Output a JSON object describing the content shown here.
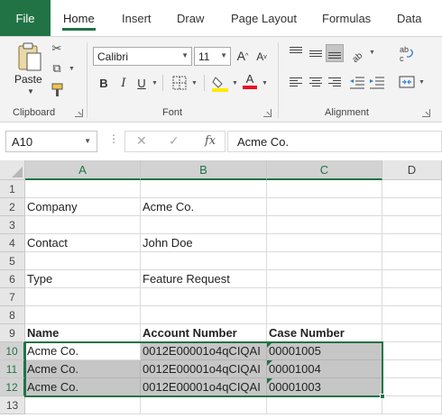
{
  "tabs": [
    "File",
    "Home",
    "Insert",
    "Draw",
    "Page Layout",
    "Formulas",
    "Data"
  ],
  "active_tab": "Home",
  "ribbon": {
    "clipboard": {
      "label": "Clipboard",
      "paste_label": "Paste"
    },
    "font": {
      "label": "Font",
      "font_name": "Calibri",
      "font_size": "11",
      "bold": "B",
      "italic": "I",
      "underline": "U",
      "grow": "A",
      "shrink": "A",
      "font_color_glyph": "A",
      "highlight_color": "#ffeb00",
      "font_color": "#e81123"
    },
    "alignment": {
      "label": "Alignment"
    }
  },
  "formula_bar": {
    "name_box": "A10",
    "content": "Acme Co.",
    "fx_label": "fx"
  },
  "columns": [
    "A",
    "B",
    "C",
    "D"
  ],
  "rows": [
    "1",
    "2",
    "3",
    "4",
    "5",
    "6",
    "7",
    "8",
    "9",
    "10",
    "11",
    "12",
    "13"
  ],
  "cells": {
    "A2": "Company",
    "B2": "Acme Co.",
    "A4": "Contact",
    "B4": "John Doe",
    "A6": "Type",
    "B6": "Feature Request",
    "A9": "Name",
    "B9": "Account Number",
    "C9": "Case Number",
    "A10": "Acme Co.",
    "B10": "0012E00001o4qCIQAI",
    "C10": "00001005",
    "A11": "Acme Co.",
    "B11": "0012E00001o4qCIQAI",
    "C11": "00001004",
    "A12": "Acme Co.",
    "B12": "0012E00001o4qCIQAI",
    "C12": "00001003"
  },
  "selection": "A10:C12",
  "accent_color": "#217346"
}
